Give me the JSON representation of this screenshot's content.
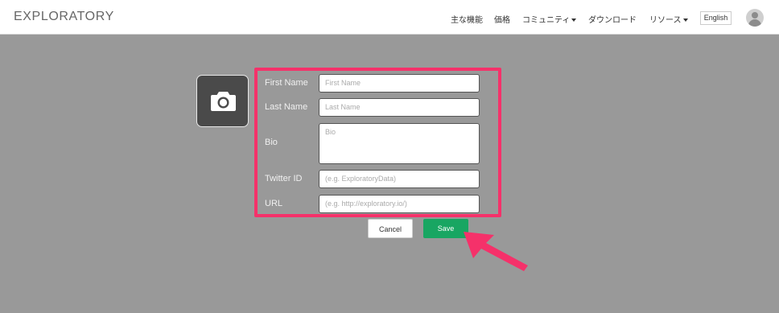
{
  "header": {
    "logo": "EXPLORATORY",
    "nav": [
      {
        "label": "主な機能",
        "dropdown": false
      },
      {
        "label": "価格",
        "dropdown": false
      },
      {
        "label": "コミュニティ",
        "dropdown": true
      },
      {
        "label": "ダウンロード",
        "dropdown": false
      },
      {
        "label": "リソース",
        "dropdown": true
      }
    ],
    "language_button": "English"
  },
  "profile": {
    "photo_icon": "camera-icon",
    "fields": {
      "first_name": {
        "label": "First Name",
        "placeholder": "First Name"
      },
      "last_name": {
        "label": "Last Name",
        "placeholder": "Last Name"
      },
      "bio": {
        "label": "Bio",
        "placeholder": "Bio"
      },
      "twitter": {
        "label": "Twitter ID",
        "placeholder": "(e.g. ExploratoryData)"
      },
      "url": {
        "label": "URL",
        "placeholder": "(e.g. http://exploratory.io/)"
      }
    },
    "cancel_label": "Cancel",
    "save_label": "Save"
  },
  "colors": {
    "highlight": "#f5316a",
    "save_button": "#18a662",
    "background": "#999999"
  }
}
